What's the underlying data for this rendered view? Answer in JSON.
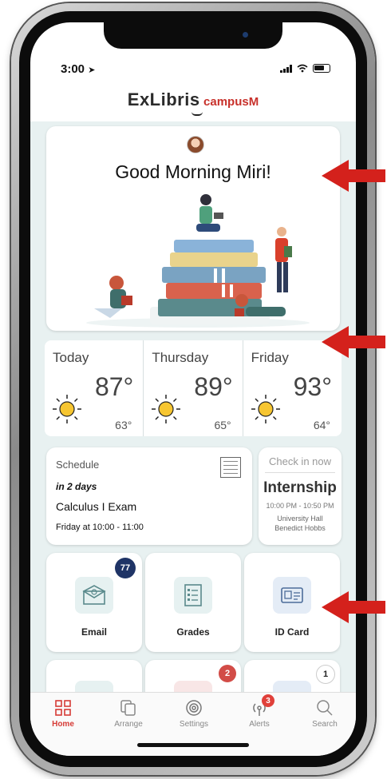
{
  "status": {
    "time": "3:00"
  },
  "brand": {
    "name": "ExLibris",
    "product": "campusM"
  },
  "greeting": {
    "text": "Good Morning Miri!"
  },
  "weather": [
    {
      "day": "Today",
      "high": "87°",
      "low": "63°",
      "icon": "sun-icon"
    },
    {
      "day": "Thursday",
      "high": "89°",
      "low": "65°",
      "icon": "sun-icon"
    },
    {
      "day": "Friday",
      "high": "93°",
      "low": "64°",
      "icon": "sun-icon"
    }
  ],
  "schedule": {
    "label": "Schedule",
    "when": "in 2 days",
    "title": "Calculus I Exam",
    "time": "Friday at 10:00 - 11:00"
  },
  "checkin": {
    "button": "Check in now",
    "title": "Internship",
    "time": "10:00 PM - 10:50 PM",
    "place": "University Hall",
    "person": "Benedict Hobbs"
  },
  "tiles": [
    {
      "label": "Email",
      "icon": "email-icon",
      "badge": "77"
    },
    {
      "label": "Grades",
      "icon": "grades-icon"
    },
    {
      "label": "ID Card",
      "icon": "id-card-icon"
    }
  ],
  "tiles_row2": [
    {
      "badge": ""
    },
    {
      "badge": "2"
    },
    {
      "badge": "1"
    }
  ],
  "tabs": [
    {
      "label": "Home",
      "icon": "home-icon",
      "active": true
    },
    {
      "label": "Arrange",
      "icon": "arrange-icon"
    },
    {
      "label": "Settings",
      "icon": "settings-icon"
    },
    {
      "label": "Alerts",
      "icon": "alerts-icon",
      "badge": "3"
    },
    {
      "label": "Search",
      "icon": "search-icon"
    }
  ],
  "colors": {
    "accent": "#d63b36",
    "badge_navy": "#1f3466",
    "background": "#e8f1f1",
    "arrow": "#d4211c"
  }
}
